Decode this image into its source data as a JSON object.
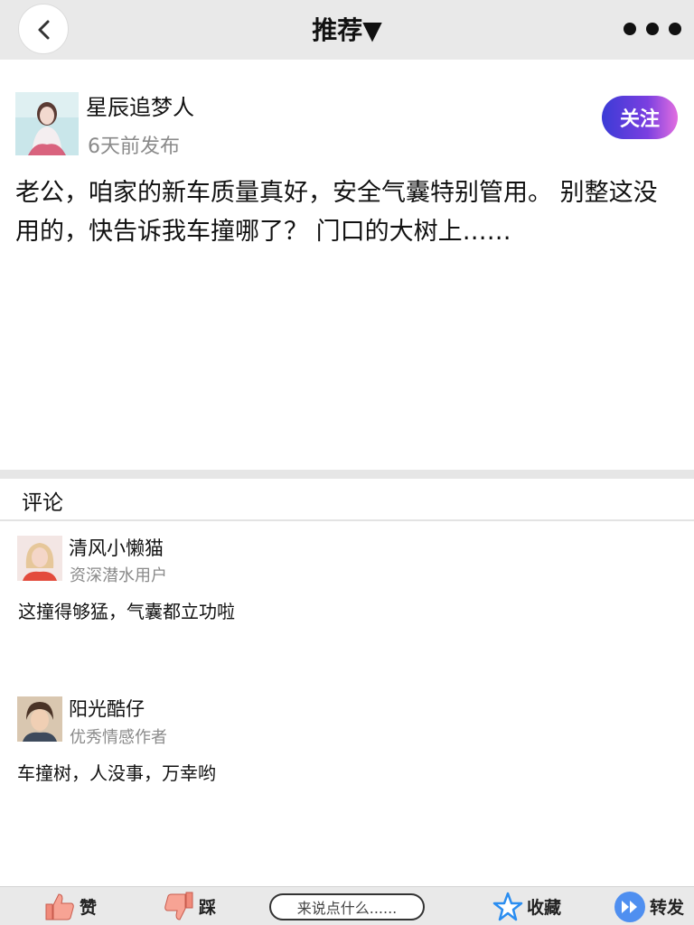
{
  "header": {
    "title": "推荐▼"
  },
  "post": {
    "author": "星辰追梦人",
    "time": "6天前发布",
    "follow_label": "关注",
    "content": "老公，咱家的新车质量真好，安全气囊特别管用。 别整这没用的，快告诉我车撞哪了？ 门口的大树上……"
  },
  "comments": {
    "title": "评论",
    "items": [
      {
        "name": "清风小懒猫",
        "role": "资深潜水用户",
        "text": "这撞得够猛，气囊都立功啦"
      },
      {
        "name": "阳光酷仔",
        "role": "优秀情感作者",
        "text": "车撞树，人没事，万幸哟"
      }
    ]
  },
  "toolbar": {
    "like_label": "赞",
    "dislike_label": "踩",
    "input_placeholder": "来说点什么......",
    "favorite_label": "收藏",
    "share_label": "转发"
  },
  "colors": {
    "follow_gradient_start": "#3b3bd6",
    "follow_gradient_end": "#e26ee0",
    "star": "#2a8df0",
    "share": "#4f8ff0",
    "thumb": "#f08a7a"
  },
  "icons": [
    "back-arrow-icon",
    "more-dots-icon",
    "thumbs-up-icon",
    "thumbs-down-icon",
    "star-icon",
    "forward-icon"
  ]
}
